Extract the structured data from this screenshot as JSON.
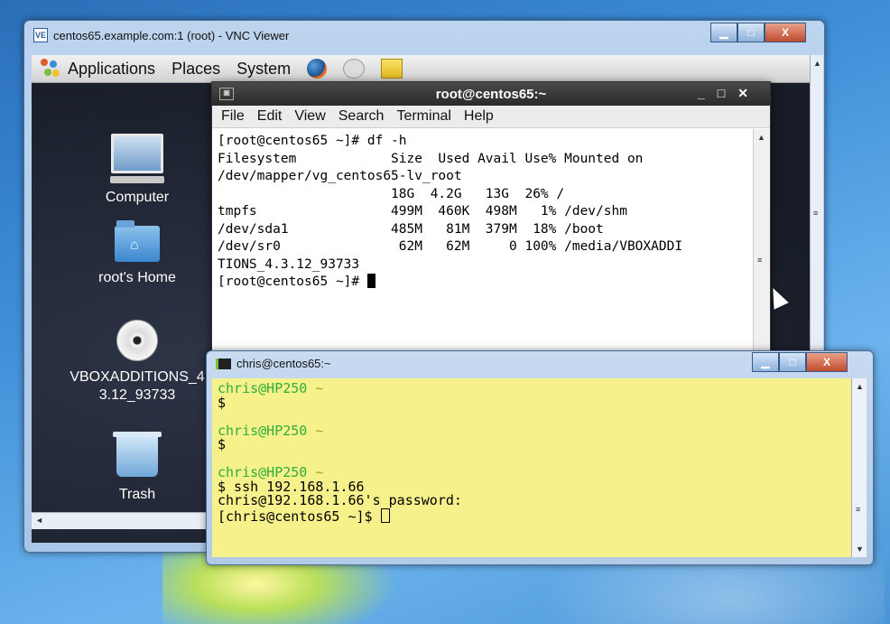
{
  "vnc": {
    "title": "centos65.example.com:1 (root) - VNC Viewer",
    "logo": "VE",
    "controls": {
      "min": "▁",
      "max": "□",
      "close": "X"
    }
  },
  "panel": {
    "items": [
      "Applications",
      "Places",
      "System"
    ]
  },
  "desktop_icons": [
    {
      "label": "Computer",
      "icon": "computer-icon"
    },
    {
      "label": "root's Home",
      "icon": "home-folder-icon"
    },
    {
      "label": "VBOXADDITIONS_4.3.12_93733",
      "label_line1": "VBOXADDITIONS_4",
      "label_line2": "3.12_93733",
      "icon": "cd-icon"
    },
    {
      "label": "Trash",
      "icon": "trash-icon"
    }
  ],
  "terminal": {
    "title": "root@centos65:~",
    "menu": [
      "File",
      "Edit",
      "View",
      "Search",
      "Terminal",
      "Help"
    ],
    "lines": [
      "[root@centos65 ~]# df -h",
      "Filesystem            Size  Used Avail Use% Mounted on",
      "/dev/mapper/vg_centos65-lv_root",
      "                      18G  4.2G   13G  26% /",
      "tmpfs                 499M  460K  498M   1% /dev/shm",
      "/dev/sda1             485M   81M  379M  18% /boot",
      "/dev/sr0               62M   62M     0 100% /media/VBOXADDI",
      "TIONS_4.3.12_93733"
    ],
    "prompt": "[root@centos65 ~]# "
  },
  "cygwin": {
    "title": "chris@centos65:~",
    "blocks": [
      {
        "user": "chris@HP250",
        "path": " ~",
        "cmd": "$"
      },
      {
        "user": "chris@HP250",
        "path": " ~",
        "cmd": "$"
      },
      {
        "user": "chris@HP250",
        "path": " ~",
        "cmd": "$ ssh 192.168.1.66"
      }
    ],
    "password_line": "chris@192.168.1.66's password:",
    "final_prompt": "[chris@centos65 ~]$ "
  }
}
